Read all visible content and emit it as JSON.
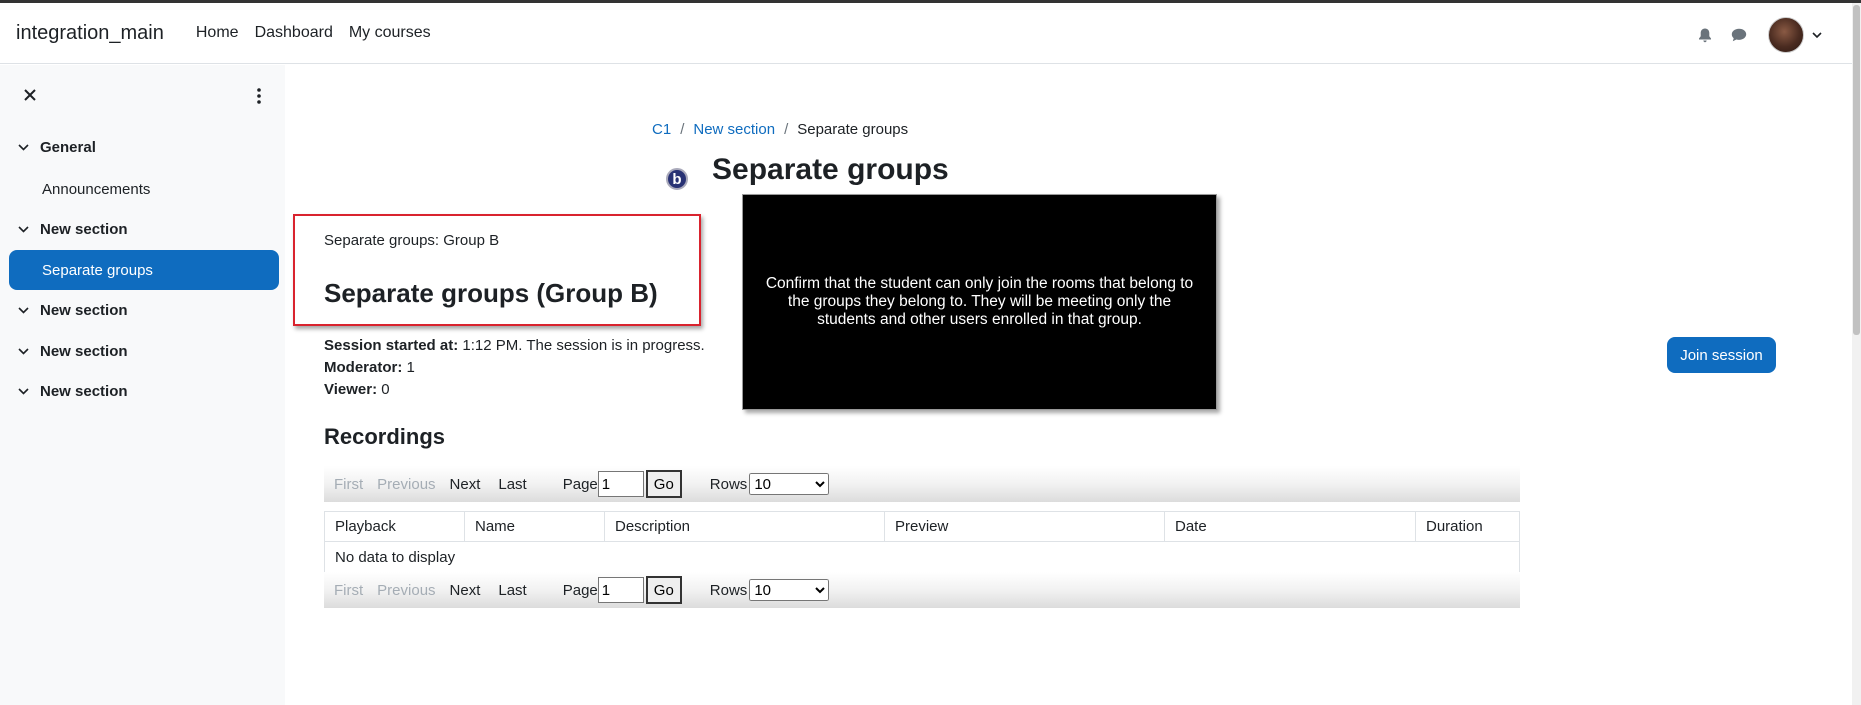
{
  "navbar": {
    "brand": "integration_main",
    "links": [
      "Home",
      "Dashboard",
      "My courses"
    ]
  },
  "drawer": {
    "sections": [
      {
        "label": "General"
      },
      {
        "label": "New section"
      },
      {
        "label": "New section"
      },
      {
        "label": "New section"
      },
      {
        "label": "New section"
      }
    ],
    "activities": {
      "announcements": "Announcements",
      "separate_groups": "Separate groups"
    }
  },
  "breadcrumb": {
    "items": [
      "C1",
      "New section",
      "Separate groups"
    ],
    "separator": "/"
  },
  "page": {
    "icon_letter": "b",
    "title": "Separate groups"
  },
  "group": {
    "selector_text": "Separate groups: Group B",
    "title": "Separate groups (Group B)"
  },
  "session": {
    "started_label": "Session started at:",
    "started_value": "1:12 PM. The session is in progress.",
    "moderator_label": "Moderator:",
    "moderator_value": "1",
    "viewer_label": "Viewer:",
    "viewer_value": "0"
  },
  "note": "Confirm that the student can only join the rooms that belong to the groups they belong to. They will be meeting only the students and other users enrolled in that group.",
  "join_button": "Join session",
  "recordings": {
    "title": "Recordings",
    "pager": {
      "first": "First",
      "previous": "Previous",
      "next": "Next",
      "last": "Last",
      "page_label": "Page",
      "page_value": "1",
      "go": "Go",
      "rows_label": "Rows",
      "rows_value": "10"
    },
    "columns": [
      "Playback",
      "Name",
      "Description",
      "Preview",
      "Date",
      "Duration"
    ],
    "empty": "No data to display"
  },
  "colors": {
    "primary": "#0f6cbf",
    "highlight_border": "#d9232e"
  }
}
